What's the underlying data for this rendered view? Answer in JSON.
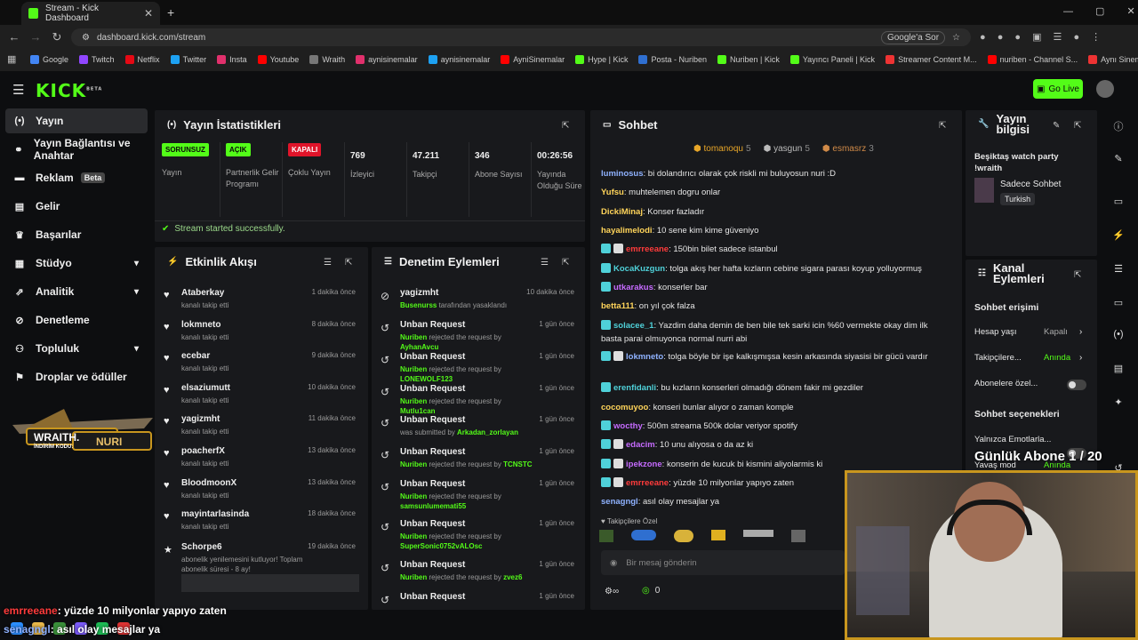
{
  "browser": {
    "tab_title": "Stream - Kick Dashboard",
    "url": "dashboard.kick.com/stream",
    "google_btn": "Google'a Sor",
    "bookmarks": [
      "Google",
      "Twitch",
      "Netflix",
      "Twitter",
      "Insta",
      "Youtube",
      "Wraith",
      "aynisinemalar",
      "aynisinemalar",
      "AyniSinemalar",
      "Hype | Kick",
      "Posta - Nuriben",
      "Nuriben | Kick",
      "Yayıncı Paneli | Kick",
      "Streamer Content M...",
      "nuriben - Channel S...",
      "Aynı Sinemalar - Ça..."
    ]
  },
  "header": {
    "logo": "KICK",
    "beta": "BETA",
    "go_live": "Go Live"
  },
  "sidebar": {
    "items": [
      {
        "label": "Yayın",
        "icon": "broadcast-icon"
      },
      {
        "label": "Yayın Bağlantısı ve Anahtar",
        "icon": "link-icon"
      },
      {
        "label": "Reklam",
        "icon": "ad-icon",
        "badge": "Beta"
      },
      {
        "label": "Gelir",
        "icon": "wallet-icon"
      },
      {
        "label": "Başarılar",
        "icon": "trophy-icon"
      },
      {
        "label": "Stüdyo",
        "icon": "studio-icon"
      },
      {
        "label": "Analitik",
        "icon": "chart-icon"
      },
      {
        "label": "Denetleme",
        "icon": "moderation-icon"
      },
      {
        "label": "Topluluk",
        "icon": "community-icon"
      },
      {
        "label": "Droplar ve ödüller",
        "icon": "gift-icon"
      }
    ],
    "promo": {
      "brand": "WRAITH.",
      "name": "NURI",
      "code_label": "İNDİRİM KODU:"
    }
  },
  "stats": {
    "title": "Yayın İstatistikleri",
    "items": [
      {
        "badge": "SORUNSUZ",
        "label": "Yayın",
        "color": "#53fc18"
      },
      {
        "badge": "AÇIK",
        "label": "Partnerlik Gelir Programı",
        "color": "#53fc18"
      },
      {
        "badge": "KAPALI",
        "label": "Çoklu Yayın",
        "color": "#e0142a"
      },
      {
        "value": "769",
        "label": "İzleyici"
      },
      {
        "value": "47.211",
        "label": "Takipçi"
      },
      {
        "value": "346",
        "label": "Abone Sayısı"
      },
      {
        "value": "00:26:56",
        "label": "Yayında Olduğu Süre"
      }
    ],
    "success": "Stream started successfully."
  },
  "activity": {
    "title": "Etkinlik Akışı",
    "rows": [
      {
        "name": "Ataberkay",
        "sub": "kanalı takip etti",
        "time": "1 dakika önce"
      },
      {
        "name": "lokmneto",
        "sub": "kanalı takip etti",
        "time": "8 dakika önce"
      },
      {
        "name": "ecebar",
        "sub": "kanalı takip etti",
        "time": "9 dakika önce"
      },
      {
        "name": "elsaziumutt",
        "sub": "kanalı takip etti",
        "time": "10 dakika önce"
      },
      {
        "name": "yagizmht",
        "sub": "kanalı takip etti",
        "time": "11 dakika önce"
      },
      {
        "name": "poacherfX",
        "sub": "kanalı takip etti",
        "time": "13 dakika önce"
      },
      {
        "name": "BloodmoonX",
        "sub": "kanalı takip etti",
        "time": "13 dakika önce"
      },
      {
        "name": "mayintarlasinda",
        "sub": "kanalı takip etti",
        "time": "18 dakika önce"
      },
      {
        "name": "Schorpe6",
        "sub": "abonelik yenilemesini kutluyor! Toplam abonelik süresi - 8 ay!",
        "time": "19 dakika önce"
      }
    ]
  },
  "moderation": {
    "title": "Denetim Eylemleri",
    "rows": [
      {
        "title": "yagizmht",
        "actor": "Busenurss",
        "rest": " tarafından yasaklandı",
        "time": "10 dakika önce"
      },
      {
        "title": "Unban Request",
        "actor": "Nuriben",
        "rest": " rejected the request by ",
        "target": "AyhanAvcu",
        "time": "1 gün önce"
      },
      {
        "title": "Unban Request",
        "actor": "Nuriben",
        "rest": " rejected the request by ",
        "target": "LONEWOLF123",
        "time": "1 gün önce"
      },
      {
        "title": "Unban Request",
        "actor": "Nuriben",
        "rest": " rejected the request by ",
        "target": "Mutlu1can",
        "time": "1 gün önce"
      },
      {
        "title": "Unban Request",
        "actor": "",
        "rest": "was submitted by ",
        "target": "Arkadan_zorlayan",
        "time": "1 gün önce"
      },
      {
        "title": "Unban Request",
        "actor": "Nuriben",
        "rest": " rejected the request by ",
        "target": "TCNSTC",
        "time": "1 gün önce"
      },
      {
        "title": "Unban Request",
        "actor": "Nuriben",
        "rest": " rejected the request by ",
        "target": "samsunlumemati55",
        "time": "1 gün önce"
      },
      {
        "title": "Unban Request",
        "actor": "Nuriben",
        "rest": " rejected the request by ",
        "target": "SuperSonic0752vALOsc",
        "time": "1 gün önce"
      },
      {
        "title": "Unban Request",
        "actor": "Nuriben",
        "rest": " rejected the request by ",
        "target": "zvez6",
        "time": "1 gün önce"
      },
      {
        "title": "Unban Request",
        "actor": "",
        "rest": "",
        "target": "",
        "time": "1 gün önce"
      }
    ]
  },
  "chat": {
    "title": "Sohbet",
    "top": [
      {
        "name": "tomanoqu",
        "n": "5"
      },
      {
        "name": "yasgun",
        "n": "5"
      },
      {
        "name": "esmasrz",
        "n": "3"
      }
    ],
    "messages": [
      {
        "user": "luminosus",
        "color": "#8fb2ff",
        "text": "bi dolandırıcı olarak çok riskli mi buluyosun nuri :D"
      },
      {
        "user": "Yufsu",
        "color": "#ffd45a",
        "text": "muhtelemen dogru onlar"
      },
      {
        "user": "DickiMinaj",
        "color": "#ffd45a",
        "text": "Konser fazladır"
      },
      {
        "user": "hayalimelodi",
        "color": "#ffd45a",
        "text": "10 sene kim kime güveniyo"
      },
      {
        "user": "emrreeane",
        "color": "#ff3b3b",
        "text": "150bin bilet sadece istanbul"
      },
      {
        "user": "KocaKuzgun",
        "color": "#4fd1d9",
        "text": "tolga akış her hafta kızların cebine sigara parası koyup yolluyormuş"
      },
      {
        "user": "utkarakus",
        "color": "#c66bff",
        "text": "konserler bar"
      },
      {
        "user": "betta111",
        "color": "#ffd45a",
        "text": "on yıl çok falza"
      },
      {
        "user": "solacee_1",
        "color": "#4fd1d9",
        "text": "Yazdim daha demin de ben bile tek sarki icin %60 vermekte okay dim ilk basta parai olmuyonca normal nurri abi"
      },
      {
        "user": "lokmneto",
        "color": "#8fb2ff",
        "text": "tolga böyle bir işe kalkışmışsa kesin arkasında siyasisi bir gücü vardır"
      },
      {
        "user": "erenfidanli",
        "color": "#4fd1d9",
        "text": "bu kızların konserleri olmadığı dönem fakir mi gezdiler"
      },
      {
        "user": "cocomuyoo",
        "color": "#ffd45a",
        "text": "konseri bunlar alıyor o zaman komple"
      },
      {
        "user": "wocthy",
        "color": "#c66bff",
        "text": "500m streama 500k dolar veriyor spotify"
      },
      {
        "user": "edacim",
        "color": "#c66bff",
        "text": "10 unu alıyosa o da az ki"
      },
      {
        "user": "ipekzone",
        "color": "#c66bff",
        "text": "konserin de kucuk bi kismini aliyolarmis ki"
      },
      {
        "user": "emrreeane",
        "color": "#ff3b3b",
        "text": "yüzde 10 milyonlar yapıyo zaten"
      },
      {
        "user": "senagngl",
        "color": "#8fb2ff",
        "text": "asıl olay mesajlar ya"
      }
    ],
    "followers_label": "Takipçilere Özel",
    "input_placeholder": "Bir mesaj gönderin",
    "points": "0"
  },
  "info": {
    "title": "Yayın bilgisi",
    "stream_title": "Beşiktaş watch party !wraith",
    "mode": "Sadece Sohbet",
    "lang": "Turkish"
  },
  "channel": {
    "title": "Kanal Eylemleri",
    "chat_access": "Sohbet erişimi",
    "rows": [
      {
        "label": "Hesap yaşı",
        "value": "Kapalı"
      },
      {
        "label": "Takipçilere...",
        "value": "Anında"
      },
      {
        "label": "Abonelere özel...",
        "value": ""
      }
    ],
    "chat_opts": "Sohbet seçenekleri",
    "emote": "Yalnızca Emotlarla...",
    "slow": "Yavaş mod",
    "slow_val": "Anında"
  },
  "overlay": {
    "sub_goal": "Günlük Abone 1 / 20",
    "line1_user": "emrreeane",
    "line1_text": ": yüzde 10 milyonlar yapıyo zaten",
    "line2_user": "senagngl",
    "line2_text": ": asıl olay mesajlar ya"
  },
  "colors": {
    "accent": "#53fc18",
    "panel": "#18191c",
    "bg": "#0d0e10"
  }
}
